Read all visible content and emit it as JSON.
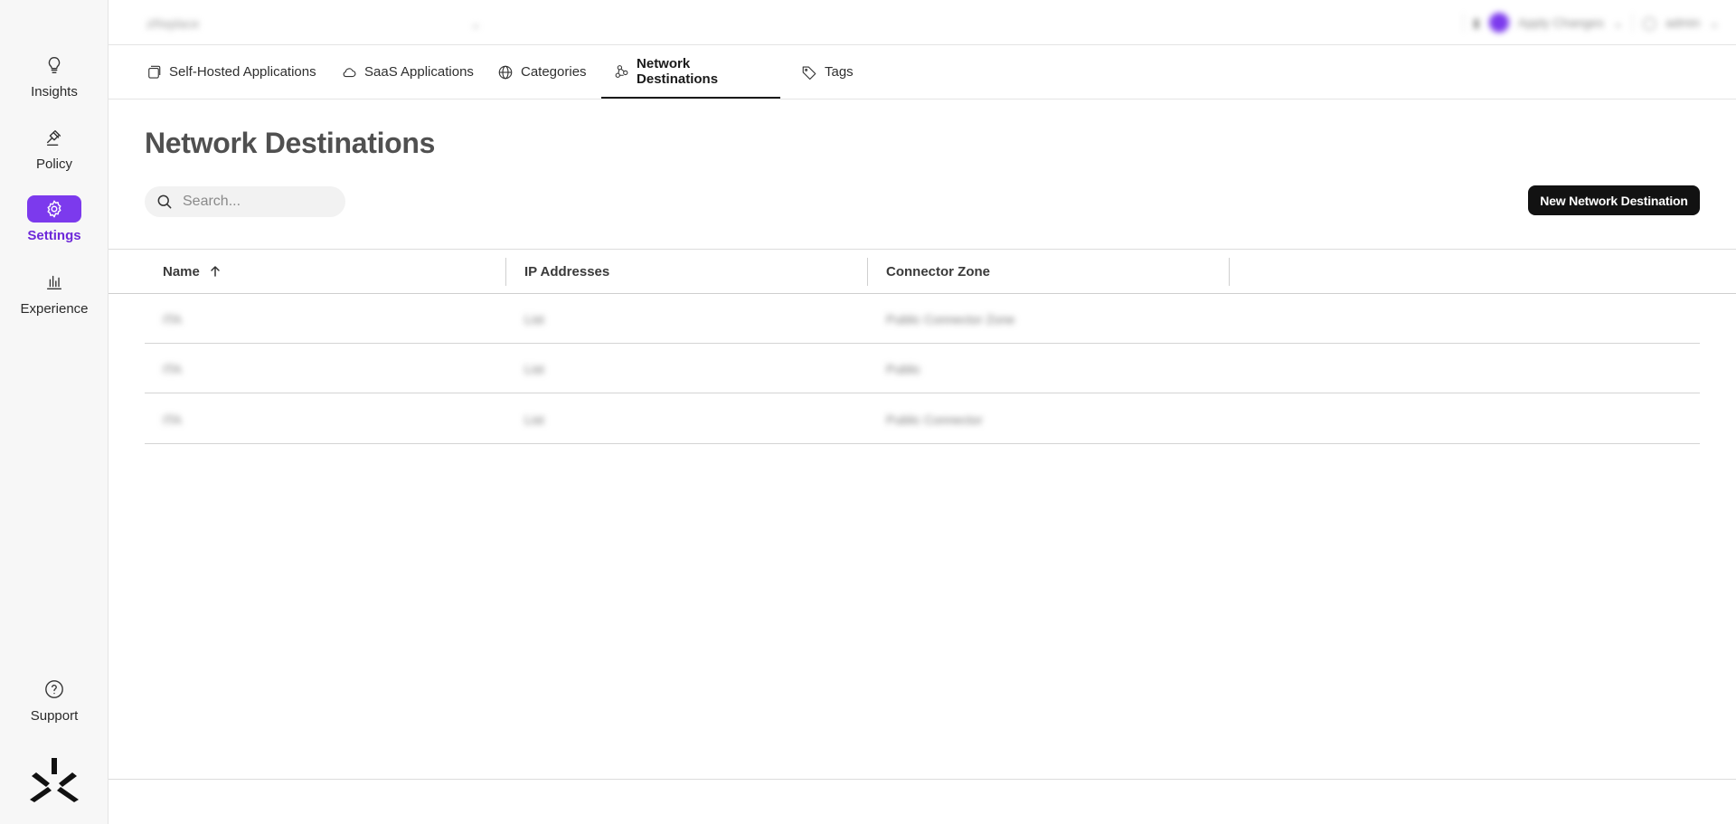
{
  "sidebar": {
    "items": [
      {
        "label": "Insights",
        "icon": "lightbulb-icon"
      },
      {
        "label": "Policy",
        "icon": "gavel-icon"
      },
      {
        "label": "Settings",
        "icon": "gear-icon",
        "active": true
      },
      {
        "label": "Experience",
        "icon": "bar-chart-icon"
      }
    ],
    "support": {
      "label": "Support",
      "icon": "help-circle-icon"
    },
    "accent_color": "#7c3aed"
  },
  "topbar": {
    "workspace": "zReplace",
    "apply_changes": "Apply Changes",
    "user": "admin"
  },
  "tabs": [
    {
      "label": "Self-Hosted Applications",
      "icon": "apps-icon"
    },
    {
      "label": "SaaS Applications",
      "icon": "cloud-icon"
    },
    {
      "label": "Categories",
      "icon": "globe-icon"
    },
    {
      "label": "Network Destinations",
      "icon": "network-icon",
      "active": true
    },
    {
      "label": "Tags",
      "icon": "tag-icon"
    }
  ],
  "main": {
    "title": "Network Destinations",
    "search_placeholder": "Search...",
    "new_button": "New Network Destination"
  },
  "table": {
    "columns": [
      "Name",
      "IP Addresses",
      "Connector Zone"
    ],
    "sort": {
      "column": "Name",
      "direction": "ascending"
    },
    "rows": [
      [
        "ITA",
        "List",
        "Public Connector Zone"
      ],
      [
        "ITA",
        "List",
        "Public"
      ],
      [
        "ITA",
        "List",
        "Public Connector"
      ]
    ]
  }
}
